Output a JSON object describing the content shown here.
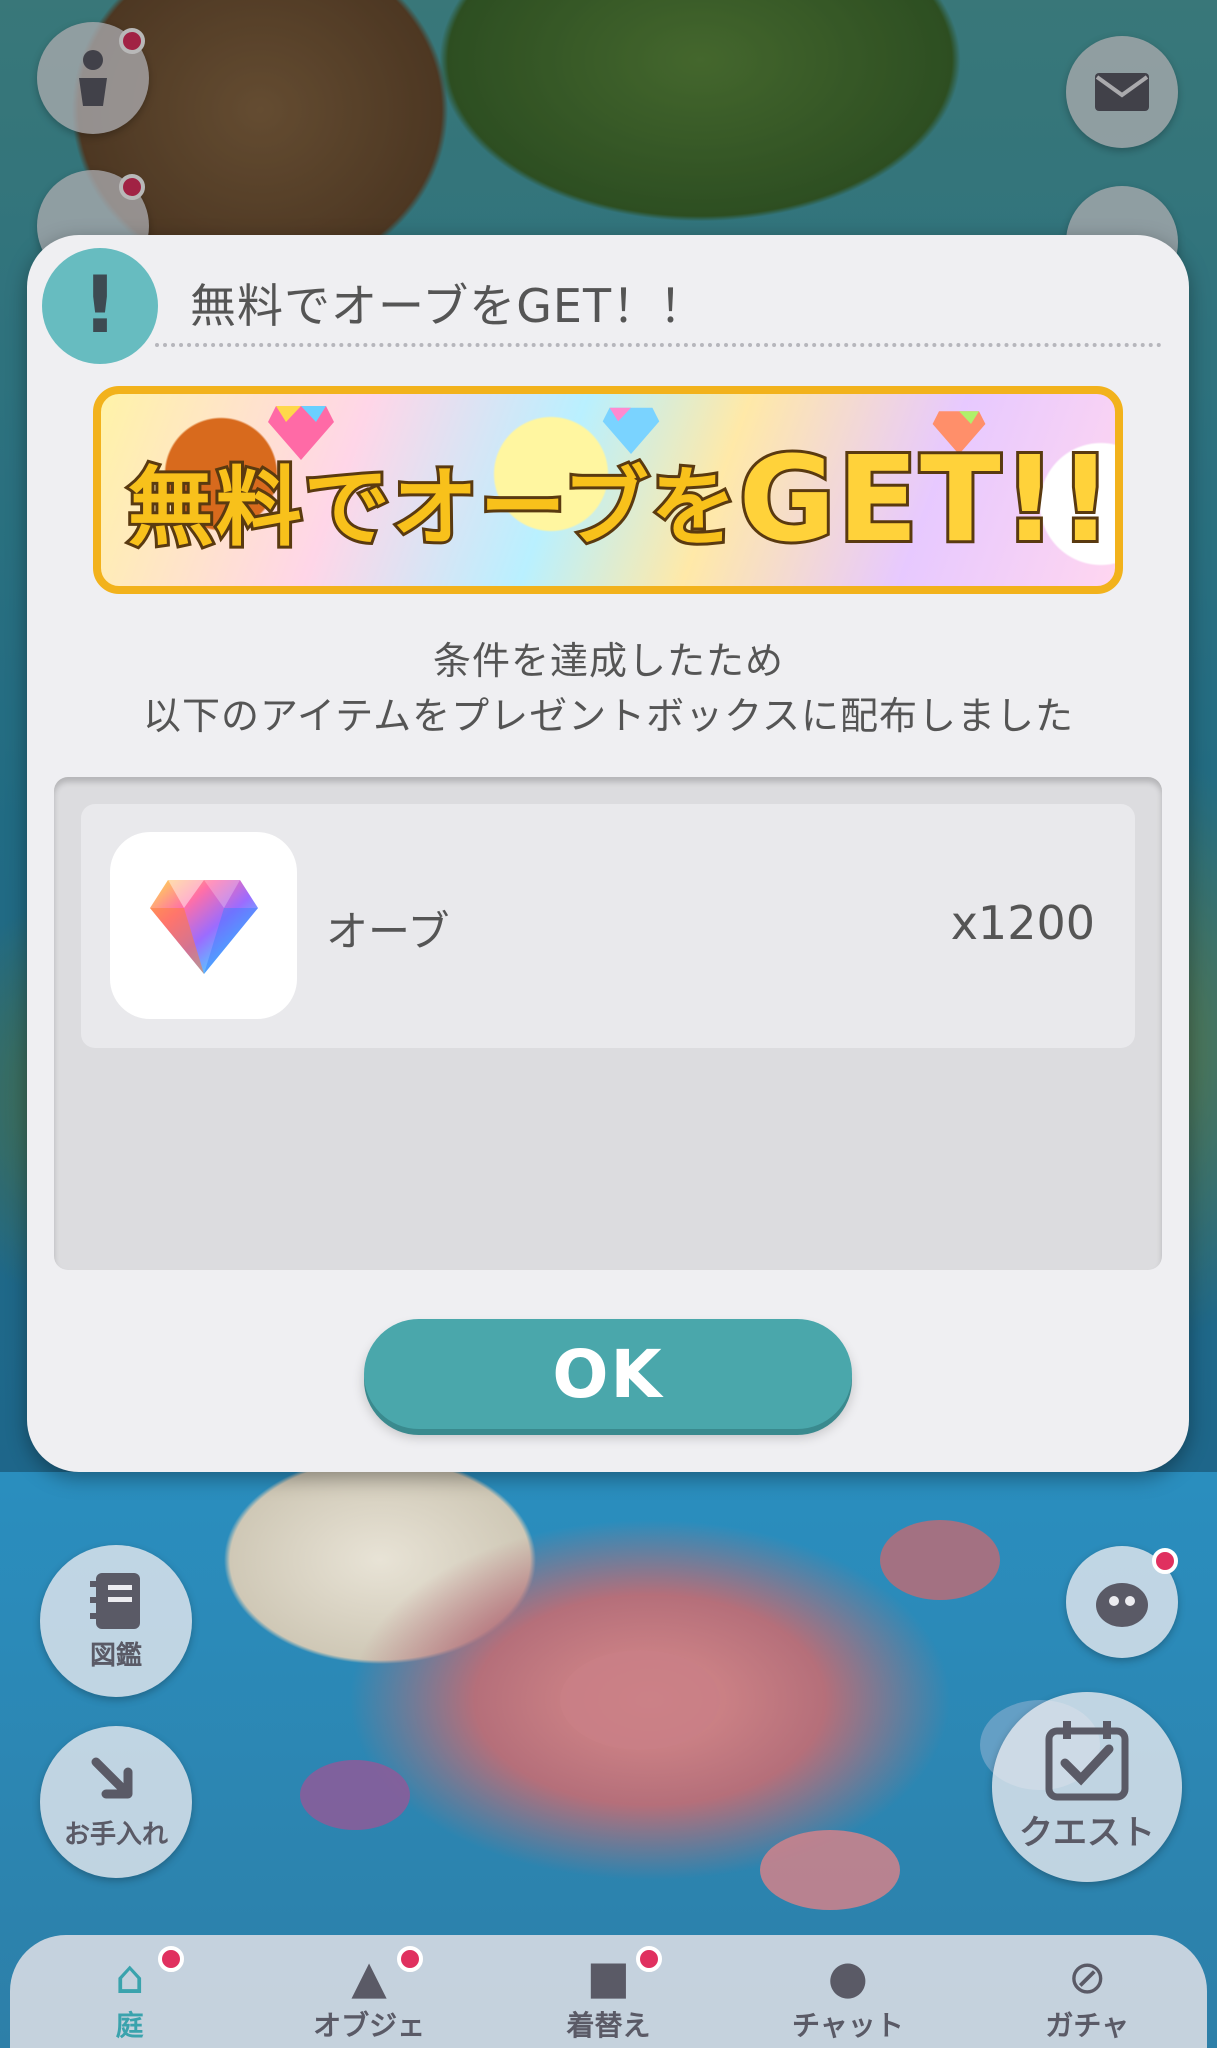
{
  "dialog": {
    "title": "無料でオーブをGET！！",
    "alert_glyph": "!",
    "banner": {
      "text_prefix": "無料でオーブを",
      "text_main": "GET!!"
    },
    "message_line1": "条件を達成したため",
    "message_line2": "以下のアイテムをプレゼントボックスに配布しました",
    "reward": {
      "icon": "rainbow-gem-icon",
      "name": "オーブ",
      "count": "x1200"
    },
    "ok_label": "OK"
  },
  "side_buttons": {
    "zukan_label": "図鑑",
    "oteire_label": "お手入れ",
    "quest_label": "クエスト"
  },
  "bottom_nav": {
    "items": [
      {
        "label": "庭",
        "icon": "house-icon",
        "active": true,
        "badge": true
      },
      {
        "label": "オブジェ",
        "icon": "object-icon",
        "active": false,
        "badge": true
      },
      {
        "label": "着替え",
        "icon": "clothes-icon",
        "active": false,
        "badge": true
      },
      {
        "label": "チャット",
        "icon": "chat-bubble-icon",
        "active": false,
        "badge": false
      },
      {
        "label": "ガチャ",
        "icon": "gacha-icon",
        "active": false,
        "badge": false
      }
    ]
  },
  "colors": {
    "accent_teal": "#4aa7ab",
    "badge_pink": "#e0305f",
    "banner_border": "#f2b21c"
  }
}
